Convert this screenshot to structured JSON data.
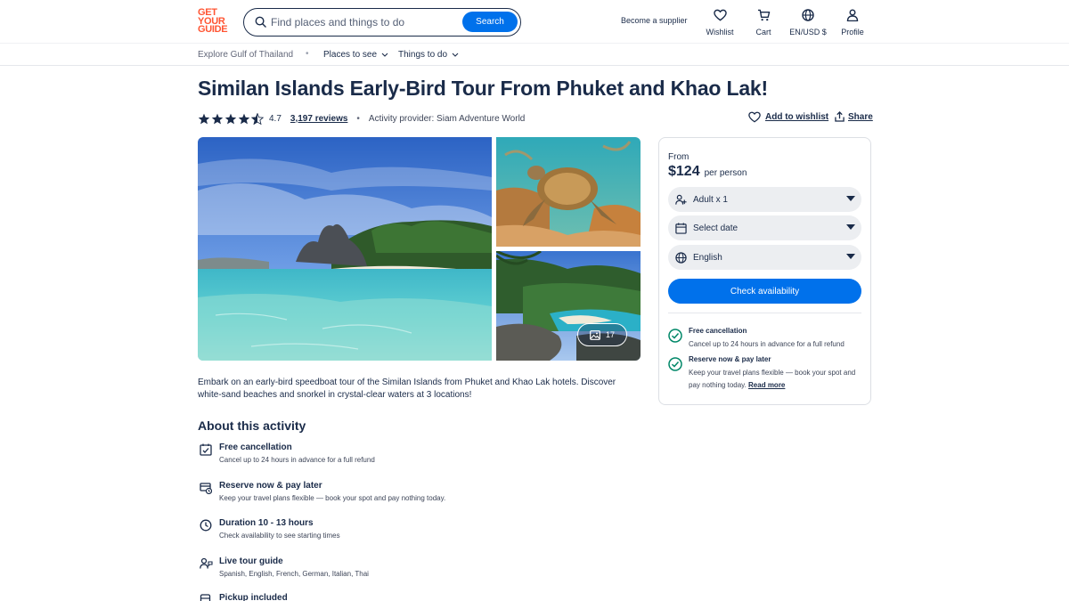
{
  "header": {
    "logo_lines": [
      "GET",
      "YOUR",
      "GUIDE"
    ],
    "search_placeholder": "Find places and things to do",
    "search_button": "Search",
    "become_supplier": "Become a supplier",
    "nav": [
      {
        "label": "Wishlist",
        "icon": "heart-icon"
      },
      {
        "label": "Cart",
        "icon": "cart-icon"
      },
      {
        "label": "EN/USD $",
        "icon": "globe-icon"
      },
      {
        "label": "Profile",
        "icon": "person-icon"
      }
    ]
  },
  "subnav": {
    "explore": "Explore Gulf of Thailand",
    "places": "Places to see",
    "things": "Things to do"
  },
  "activity": {
    "title": "Similan Islands Early-Bird Tour From Phuket and Khao Lak!",
    "rating": "4.7",
    "rating_stars": 4.7,
    "reviews": "3,197 reviews",
    "provider": "Activity provider: Siam Adventure World",
    "add_wishlist": "Add to wishlist",
    "share": "Share",
    "photo_count": "17",
    "description": "Embark on an early-bird speedboat tour of the Similan Islands from Phuket and Khao Lak hotels. Discover white-sand beaches and snorkel in crystal-clear waters at 3 locations!"
  },
  "about": {
    "heading": "About this activity",
    "items": [
      {
        "title": "Free cancellation",
        "sub": "Cancel up to 24 hours in advance for a full refund",
        "icon": "calendar-check-icon"
      },
      {
        "title": "Reserve now & pay later",
        "sub": "Keep your travel plans flexible — book your spot and pay nothing today.",
        "icon": "card-clock-icon"
      },
      {
        "title": "Duration 10 - 13 hours",
        "sub": "Check availability to see starting times",
        "icon": "clock-icon"
      },
      {
        "title": "Live tour guide",
        "sub": "Spanish, English, French, German, Italian, Thai",
        "icon": "guide-icon"
      },
      {
        "title": "Pickup included",
        "sub": "",
        "icon": "bus-icon"
      }
    ]
  },
  "booking": {
    "from": "From",
    "price": "$124",
    "per_person": "per person",
    "participants": "Adult x 1",
    "date": "Select date",
    "language": "English",
    "check_button": "Check availability",
    "free_cancel_title": "Free cancellation",
    "free_cancel_sub": "Cancel up to 24 hours in advance for a full refund",
    "reserve_title": "Reserve now & pay later",
    "reserve_sub": "Keep your travel plans flexible — book your spot and pay nothing today.",
    "read_more": "Read more"
  },
  "colors": {
    "brand": "#ff5533",
    "primary": "#0071eb",
    "text": "#1a2b49",
    "success": "#008768"
  }
}
